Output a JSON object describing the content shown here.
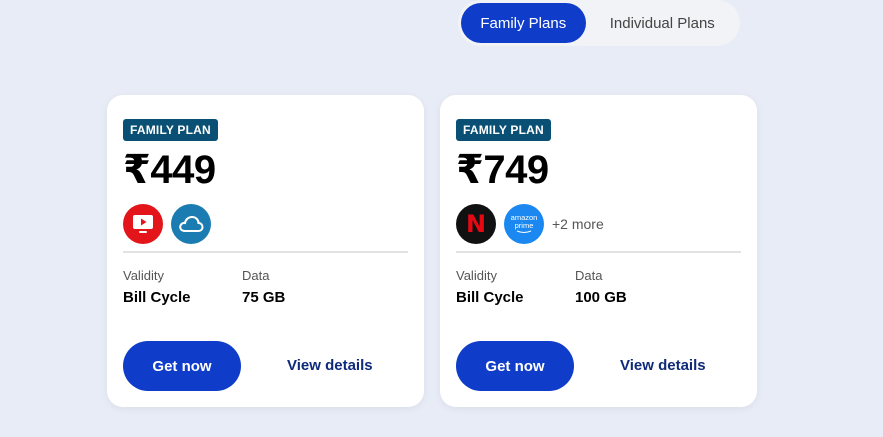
{
  "toggle": {
    "family_label": "Family Plans",
    "individual_label": "Individual Plans"
  },
  "plans": [
    {
      "badge": "FAMILY PLAN",
      "price": "₹449",
      "icons": [
        "youtube-icon",
        "cloud-icon"
      ],
      "more": "",
      "validity_label": "Validity",
      "validity_value": "Bill Cycle",
      "data_label": "Data",
      "data_value": "75 GB",
      "cta": "Get now",
      "details": "View details"
    },
    {
      "badge": "FAMILY PLAN",
      "price": "₹749",
      "icons": [
        "netflix-icon",
        "amazon-prime-icon"
      ],
      "netflix_glyph": "N",
      "prime_line1": "amazon",
      "prime_line2": "prime",
      "more": "+2 more",
      "validity_label": "Validity",
      "validity_value": "Bill Cycle",
      "data_label": "Data",
      "data_value": "100 GB",
      "cta": "Get now",
      "details": "View details"
    }
  ],
  "colors": {
    "accent": "#0f3cc9",
    "badge": "#0a5075",
    "background": "#e8ecf6"
  }
}
